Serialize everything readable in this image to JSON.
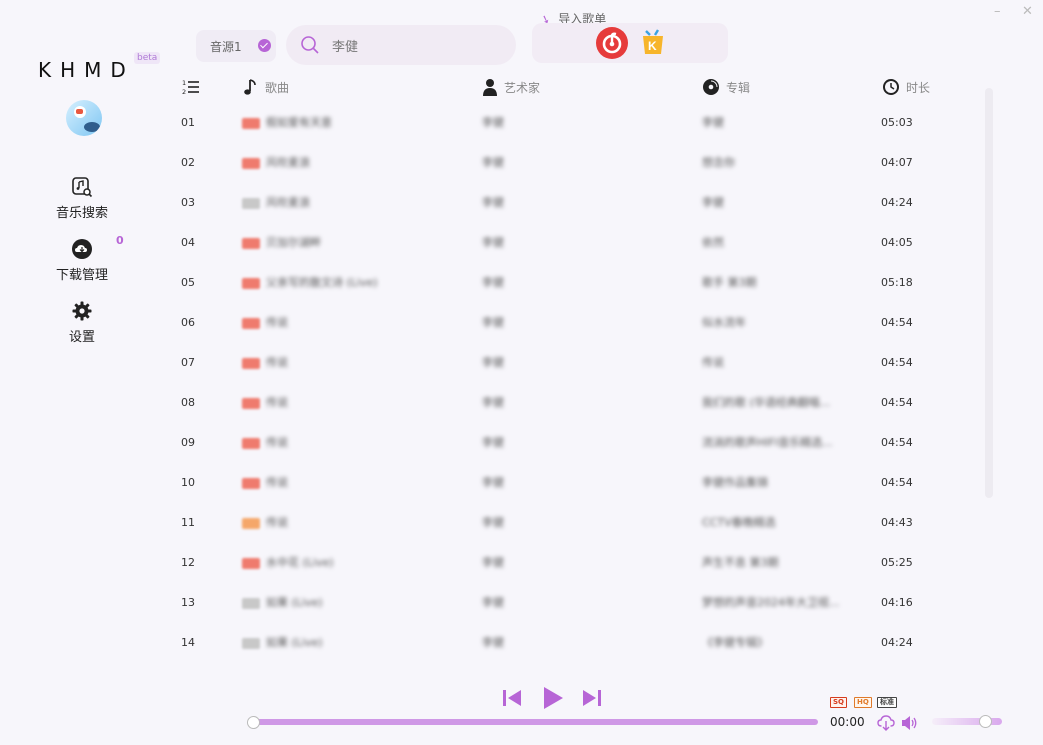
{
  "app": {
    "logo": "KHMD",
    "badge": "beta"
  },
  "window": {
    "minimize": "–",
    "close": "✕"
  },
  "sidebar": {
    "items": [
      {
        "id": "search",
        "label": "音乐搜索",
        "icon": "music-search-icon"
      },
      {
        "id": "download",
        "label": "下载管理",
        "icon": "cloud-download-icon",
        "count": "0"
      },
      {
        "id": "settings",
        "label": "设置",
        "icon": "gear-icon"
      }
    ]
  },
  "topbar": {
    "source": "音源1",
    "search_value": "李健",
    "import_label": "导入歌单",
    "import_sources": [
      "netease-music-icon",
      "kugou-music-icon"
    ]
  },
  "table": {
    "headers": {
      "index_icon": "list-ordered-icon",
      "song": "歌曲",
      "artist": "艺术家",
      "album": "专辑",
      "duration": "时长"
    },
    "rows": [
      {
        "idx": "01",
        "song": "假如爱有天意",
        "artist": "李健",
        "album": "李健",
        "dur": "05:03",
        "tag": "sq"
      },
      {
        "idx": "02",
        "song": "风吹麦浪",
        "artist": "李健",
        "album": "想念你",
        "dur": "04:07",
        "tag": "sq"
      },
      {
        "idx": "03",
        "song": "风吹麦浪",
        "artist": "李健",
        "album": "李健",
        "dur": "04:24",
        "tag": "std"
      },
      {
        "idx": "04",
        "song": "贝加尔湖畔",
        "artist": "李健",
        "album": "依然",
        "dur": "04:05",
        "tag": "sq"
      },
      {
        "idx": "05",
        "song": "父亲写的散文诗 (Live)",
        "artist": "李健",
        "album": "歌手 第3期",
        "dur": "05:18",
        "tag": "sq"
      },
      {
        "idx": "06",
        "song": "传说",
        "artist": "李健",
        "album": "似水流年",
        "dur": "04:54",
        "tag": "sq"
      },
      {
        "idx": "07",
        "song": "传说",
        "artist": "李健",
        "album": "传说",
        "dur": "04:54",
        "tag": "sq"
      },
      {
        "idx": "08",
        "song": "传说",
        "artist": "李健",
        "album": "我们的歌 (华语经典翻唱...",
        "dur": "04:54",
        "tag": "sq"
      },
      {
        "idx": "09",
        "song": "传说",
        "artist": "李健",
        "album": "流淌的歌声HIFI音乐精选...",
        "dur": "04:54",
        "tag": "sq"
      },
      {
        "idx": "10",
        "song": "传说",
        "artist": "李健",
        "album": "李健作品集锦",
        "dur": "04:54",
        "tag": "sq"
      },
      {
        "idx": "11",
        "song": "传说",
        "artist": "李健",
        "album": "CCTV春晚精选",
        "dur": "04:43",
        "tag": "hq"
      },
      {
        "idx": "12",
        "song": "水中花 (Live)",
        "artist": "李健",
        "album": "声生不息 第3期",
        "dur": "05:25",
        "tag": "sq"
      },
      {
        "idx": "13",
        "song": "如果 (Live)",
        "artist": "李健",
        "album": "梦想的声音2024年大卫视...",
        "dur": "04:16",
        "tag": "std"
      },
      {
        "idx": "14",
        "song": "如果 (Live)",
        "artist": "李健",
        "album": "《李健专辑》",
        "dur": "04:24",
        "tag": "std"
      }
    ]
  },
  "player": {
    "time": "00:00",
    "progress": 0,
    "volume": 0.75,
    "quality_badges": [
      "SQ",
      "HQ",
      "标准"
    ]
  },
  "colors": {
    "accent": "#b765d6",
    "progress": "#cf98e6",
    "sq": "#d63c1e",
    "hq": "#e07a2a"
  }
}
